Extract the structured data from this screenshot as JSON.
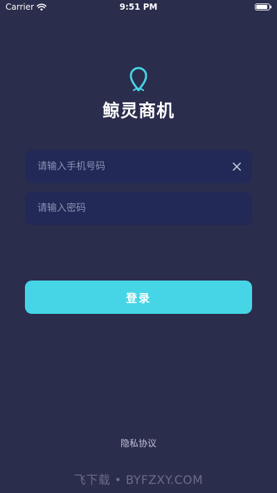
{
  "status_bar": {
    "carrier": "Carrier",
    "time": "9:51 PM",
    "battery_level": 0.9
  },
  "app": {
    "name": "鲸灵商机",
    "logo_icon": "drop-pin-logo-icon"
  },
  "form": {
    "phone_placeholder": "请输入手机号码",
    "phone_value": "",
    "password_placeholder": "请输入密码",
    "password_value": "",
    "login_label": "登录"
  },
  "footer": {
    "privacy_label": "隐私协议"
  },
  "watermark": {
    "text": "飞下载 • BYFZXY.COM"
  },
  "colors": {
    "background": "#2b2d4c",
    "input_bg": "#222956",
    "accent": "#46d5e6",
    "placeholder": "#8c91b3"
  }
}
